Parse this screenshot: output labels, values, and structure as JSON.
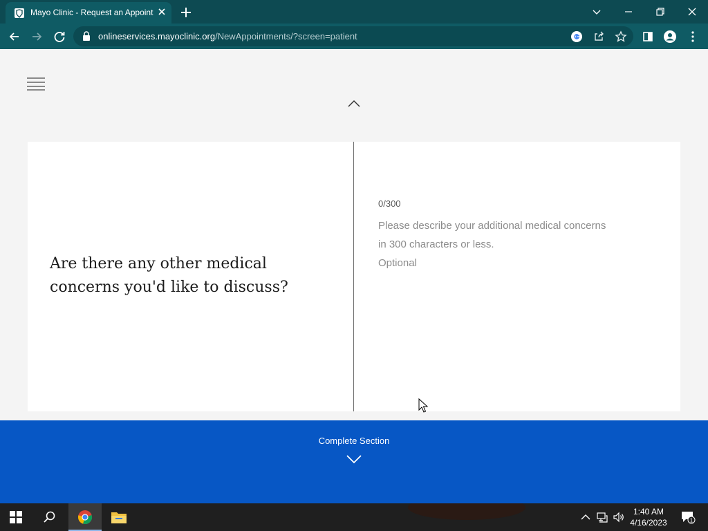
{
  "browser": {
    "tab_title": "Mayo Clinic - Request an Appointment",
    "url_domain": "onlineservices.mayoclinic.org",
    "url_path": "/NewAppointments/?screen=patient"
  },
  "page": {
    "question": "Are there any other medical concerns you'd like to discuss?",
    "counter": "0/300",
    "input_placeholder": "Please describe your additional medical concerns in 300 characters or less.",
    "optional_label": "Optional",
    "complete_label": "Complete Section"
  },
  "taskbar": {
    "time": "1:40 AM",
    "date": "4/16/2023",
    "notification_count": "1"
  },
  "colors": {
    "chrome_accent": "#0f5b64",
    "complete_bar": "#0757c5"
  }
}
